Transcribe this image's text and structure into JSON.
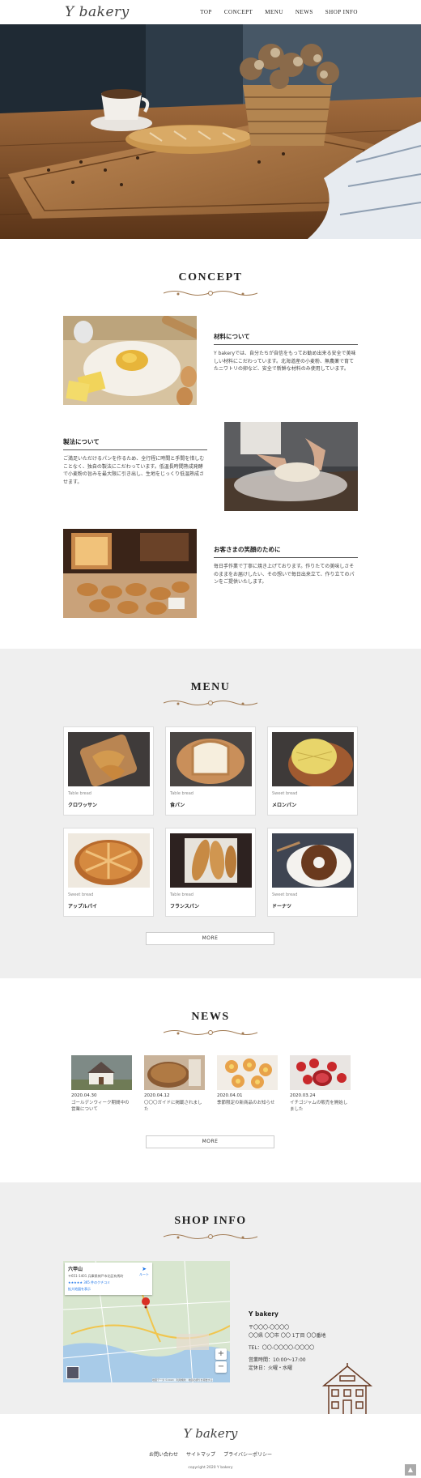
{
  "header": {
    "logo": "Y bakery",
    "nav": [
      "TOP",
      "CONCEPT",
      "MENU",
      "NEWS",
      "SHOP INFO"
    ]
  },
  "concept": {
    "title": "CONCEPT",
    "blocks": [
      {
        "heading": "材料について",
        "text": "Y bakeryでは、自分たちが自信をもってお勧め出来る安全で美味しい材料にこだわっています。北海道産の小麦粉、無農薬で育てたニワトリの卵など、安全で新鮮な材料のみ使用しています。"
      },
      {
        "heading": "製法について",
        "text": "ご満足いただけるパンを作るため、全行程に時間と手間を惜しむことなく、独自の製法にこだわっています。低温長時間熟成発酵で小麦粉の旨みを最大限に引き出し、生地をじっくり低温熟成させます。"
      },
      {
        "heading": "お客さまの笑顔のために",
        "text": "毎日手作業で丁寧に焼き上げております。作りたての美味しさそのままをお届けしたい、その想いで毎日出来立て、作り立てのパンをご提供いたします。"
      }
    ]
  },
  "menu": {
    "title": "MENU",
    "items": [
      {
        "category": "Table bread",
        "name": "クロワッサン"
      },
      {
        "category": "Table bread",
        "name": "食パン"
      },
      {
        "category": "Sweet bread",
        "name": "メロンパン"
      },
      {
        "category": "Sweet bread",
        "name": "アップルパイ"
      },
      {
        "category": "Table bread",
        "name": "フランスパン"
      },
      {
        "category": "Sweet bread",
        "name": "ドーナツ"
      }
    ],
    "more": "MORE"
  },
  "news": {
    "title": "NEWS",
    "items": [
      {
        "date": "2020.04.30",
        "text": "ゴールデンウィーク期間中の営業について"
      },
      {
        "date": "2020.04.12",
        "text": "〇〇〇ガイドに掲載されました"
      },
      {
        "date": "2020.04.01",
        "text": "季節限定の新商品のお知らせ"
      },
      {
        "date": "2020.03.24",
        "text": "イチゴジャムの販売を開始しました"
      }
    ],
    "more": "MORE"
  },
  "shop": {
    "title": "SHOP INFO",
    "map": {
      "place": "六甲山",
      "address": "〒651-1401 兵庫県神戸市北区有馬町",
      "rating": "★★★★★ 365 件のクチコミ",
      "link": "拡大地図を表示",
      "route": "ルート",
      "zoom_in": "+",
      "zoom_out": "−",
      "footer": "地図データ ©2020　利用規約　地図の誤りを報告する"
    },
    "name": "Y bakery",
    "postal": "〒〇〇〇-〇〇〇〇",
    "address": "〇〇県 〇〇市 〇〇 1丁目 〇〇番地",
    "tel": "TEL：〇〇-〇〇〇〇-〇〇〇〇",
    "hours": "営業時間：10:00〜17:00",
    "closed": "定休日：火曜・水曜"
  },
  "footer": {
    "logo": "Y bakery",
    "links": [
      "お問い合わせ",
      "サイトマップ",
      "プライバシーポリシー"
    ],
    "copyright": "copyright 2020 Y bakery",
    "totop": "▲"
  }
}
